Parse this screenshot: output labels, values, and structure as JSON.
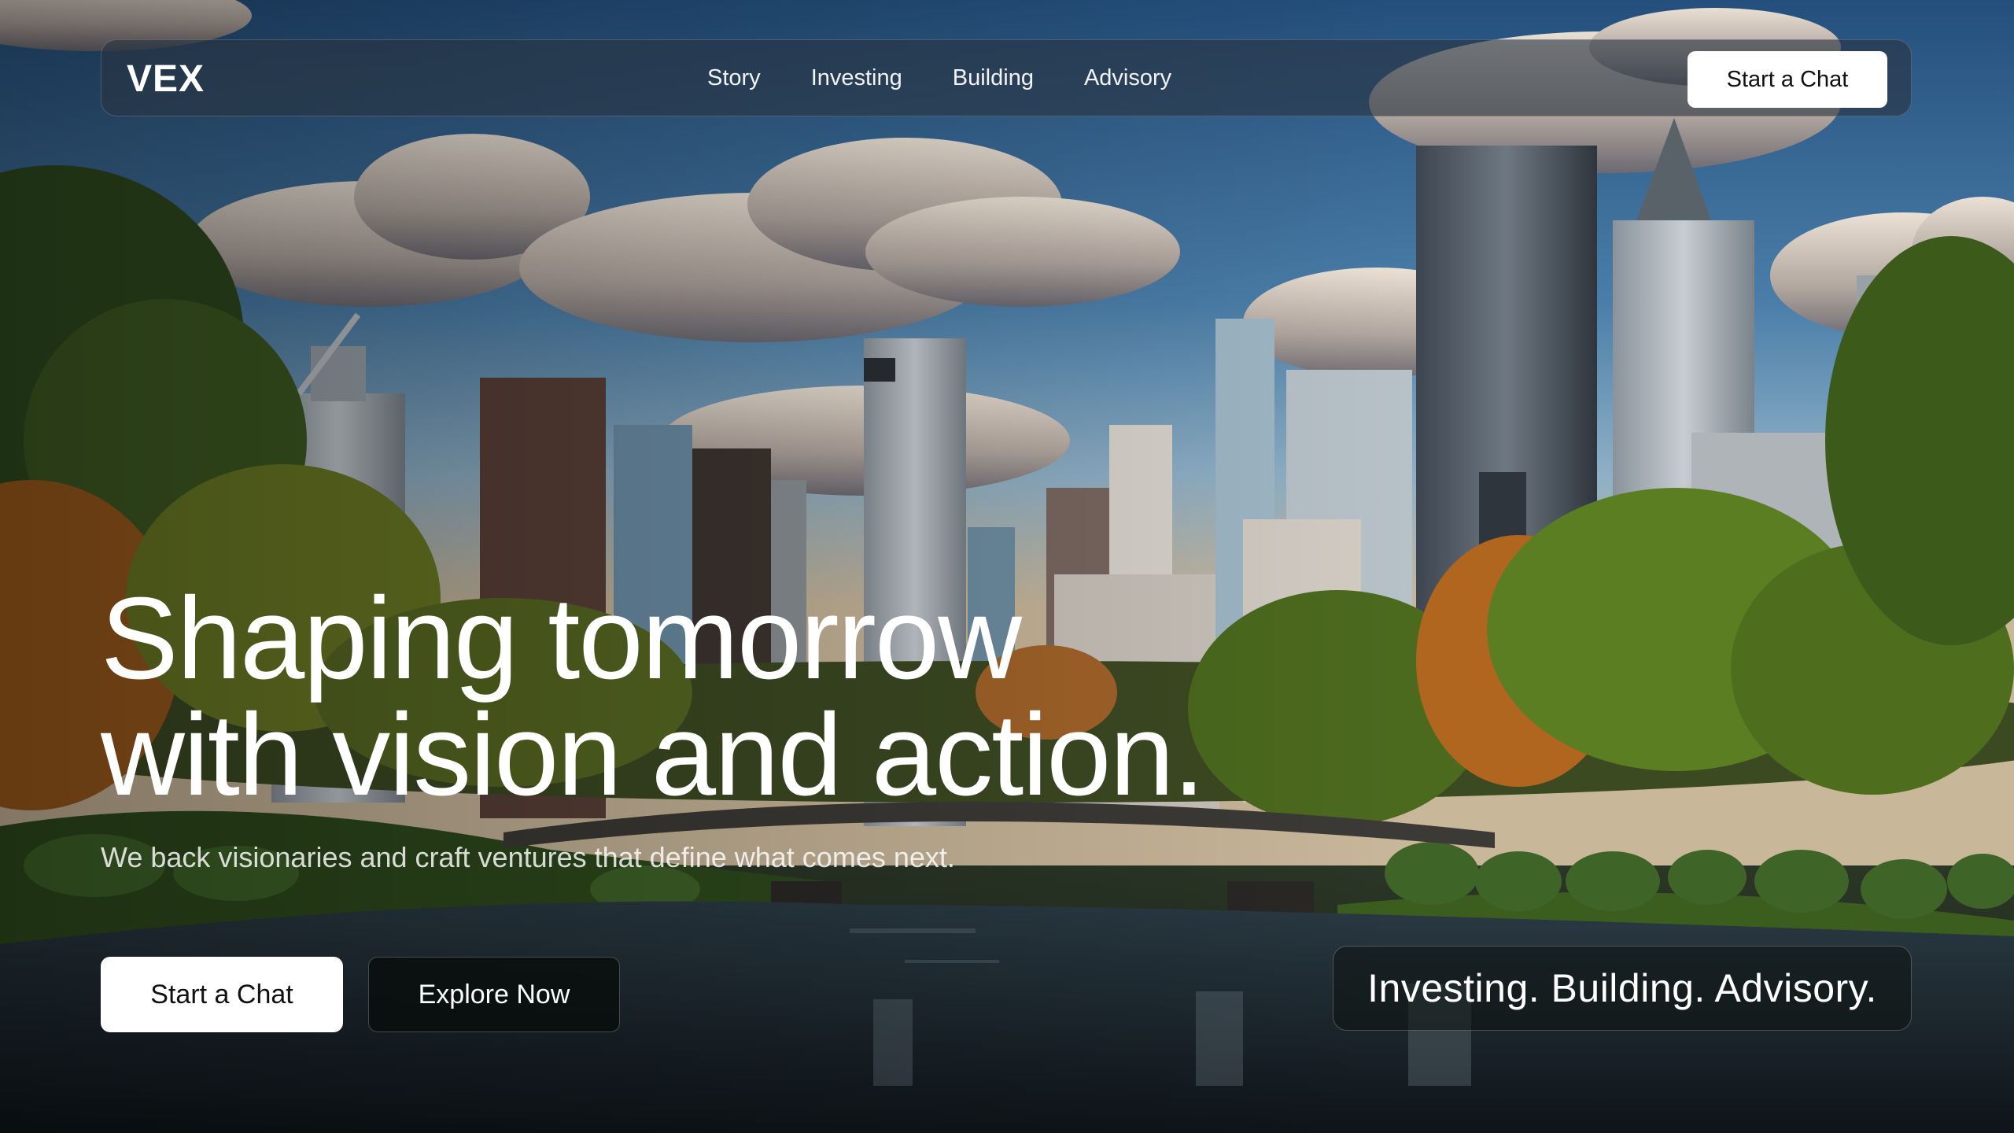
{
  "header": {
    "logo": "VEX",
    "nav": [
      "Story",
      "Investing",
      "Building",
      "Advisory"
    ],
    "cta_label": "Start a Chat"
  },
  "hero": {
    "title_line1": "Shaping tomorrow",
    "title_line2": "with vision and action.",
    "subtitle": "We back visionaries and craft ventures that define what comes next.",
    "primary_button": "Start a Chat",
    "secondary_button": "Explore Now",
    "tagline": "Investing. Building. Advisory."
  }
}
